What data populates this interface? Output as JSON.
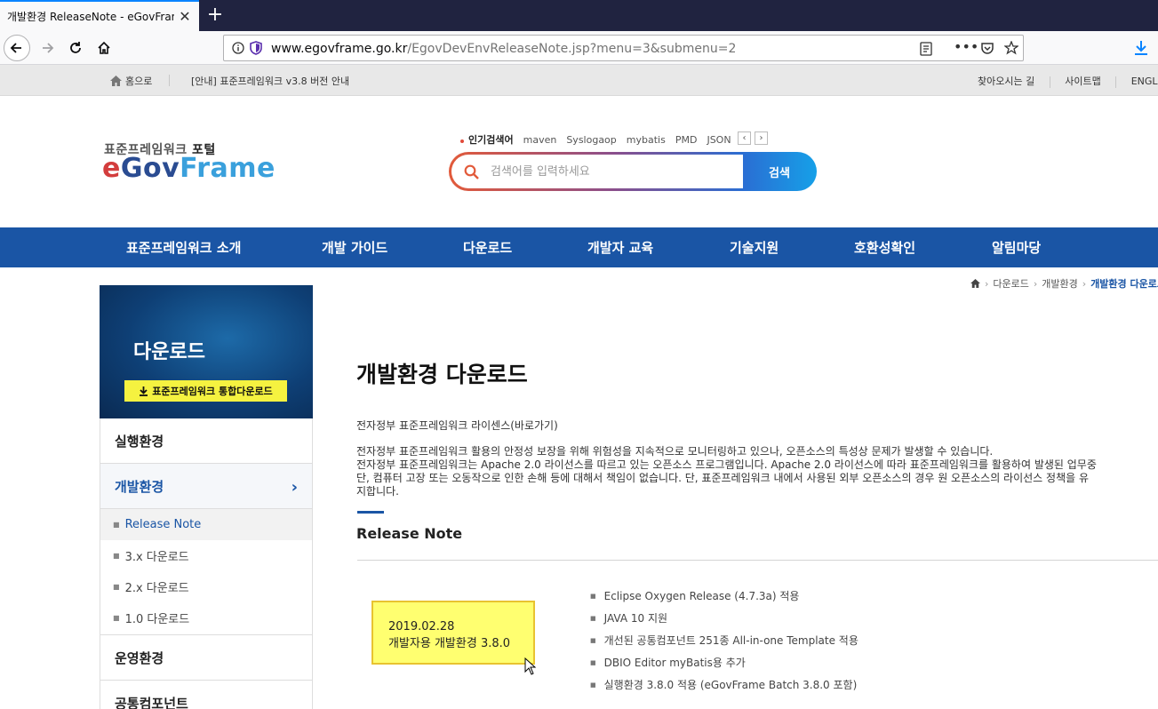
{
  "browser": {
    "tab_title": "개발환경 ReleaseNote - eGovFrame",
    "url_domain": "www.egovframe.go.kr",
    "url_path": "/EgovDevEnvReleaseNote.jsp?menu=3&submenu=2"
  },
  "utilbar": {
    "home_label": "홈으로",
    "notice": "[안내] 표준프레임워크 v3.8 버전 안내",
    "links": [
      "찾아오시는 길",
      "사이트맵",
      "ENGLISH"
    ]
  },
  "header": {
    "logo_sub_prefix": "표준프레임워크 ",
    "logo_sub_bold": "포털",
    "logo_e": "e",
    "logo_gov": "Gov",
    "logo_frame": "Frame",
    "popular_label": "인기검색어",
    "popular_keywords": [
      "maven",
      "Syslogaop",
      "mybatis",
      "PMD",
      "JSON"
    ],
    "search_placeholder": "검색어를 입력하세요",
    "search_button": "검색"
  },
  "gnb": [
    "표준프레임워크 소개",
    "개발 가이드",
    "다운로드",
    "개발자 교육",
    "기술지원",
    "호환성확인",
    "알림마당"
  ],
  "breadcrumb": [
    "다운로드",
    "개발환경",
    "개발환경 다운로드"
  ],
  "sidebar": {
    "title": "다운로드",
    "download_button": "표준프레임워크 통합다운로드",
    "items": [
      "실행환경",
      "개발환경",
      "운영환경",
      "공통컴포넌트"
    ],
    "sub_items": [
      "Release Note",
      "3.x 다운로드",
      "2.x 다운로드",
      "1.0 다운로드"
    ]
  },
  "main": {
    "title": "개발환경 다운로드",
    "license_link": "전자정부 표준프레임워크 라이센스(바로가기)",
    "license_lines": [
      "전자정부 표준프레임워크 활용의 안정성 보장을 위해 위험성을 지속적으로 모니터링하고 있으나, 오픈소스의 특성상 문제가 발생할 수 있습니다.",
      "전자정부 표준프레임워크는 Apache 2.0 라이선스를 따르고 있는 오픈소스 프로그램입니다. Apache 2.0 라이선스에 따라 표준프레임워크를 활용하여 발생된 업무중",
      "단, 컴퓨터 고장 또는 오동작으로 인한 손해 등에 대해서 책임이 없습니다. 단, 표준프레임워크 내에서 사용된 외부 오픈소스의 경우 원 오픈소스의 라이선스 정책을 유",
      "지합니다."
    ],
    "section_title": "Release Note",
    "release_date": "2019.02.28",
    "release_name": "개발자용 개발환경 3.8.0",
    "notes": [
      "Eclipse Oxygen Release (4.7.3a) 적용",
      "JAVA 10 지원",
      "개선된 공통컴포넌트 251종 All-in-one Template 적용",
      "DBIO Editor myBatis용 추가",
      "실행환경 3.8.0 적용 (eGovFrame Batch 3.8.0 포함)"
    ]
  },
  "colors": {
    "gnb": "#1a55a5",
    "accent_yellow": "#ffff70",
    "tabbar": "#202340"
  }
}
